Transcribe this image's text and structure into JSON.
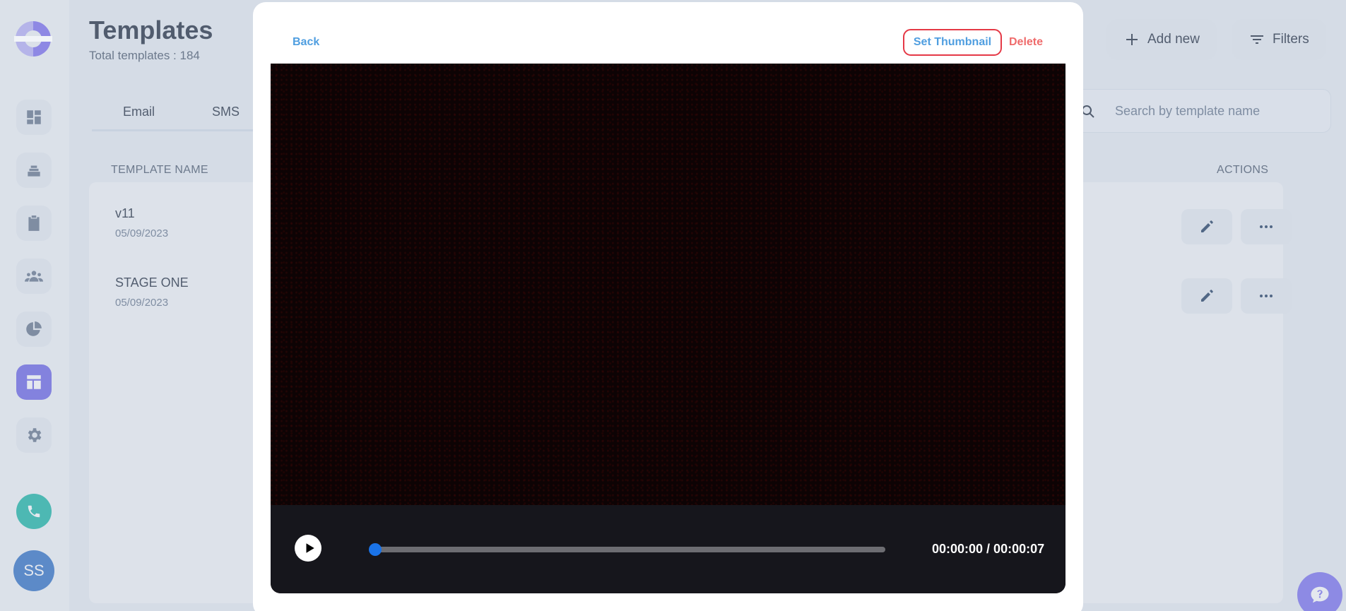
{
  "sidebar": {
    "avatar_initials": "SS",
    "active_item": "templates"
  },
  "header": {
    "title": "Templates",
    "subtitle": "Total templates : 184",
    "add_new_label": "Add new",
    "filters_label": "Filters"
  },
  "tabs": [
    {
      "label": "Email"
    },
    {
      "label": "SMS"
    }
  ],
  "search": {
    "placeholder": "Search by template name"
  },
  "table": {
    "columns": {
      "name": "TEMPLATE NAME",
      "actions": "ACTIONS"
    },
    "rows": [
      {
        "name": "v11",
        "date": "05/09/2023"
      },
      {
        "name": "STAGE ONE",
        "date": "05/09/2023"
      }
    ]
  },
  "modal": {
    "back_label": "Back",
    "set_thumbnail_label": "Set Thumbnail",
    "delete_label": "Delete",
    "video": {
      "time_display": "00:00:00 / 00:00:07",
      "progress": 0
    }
  },
  "colors": {
    "accent": "#6b63e6",
    "link": "#4f9ee0",
    "danger": "#e53946",
    "progress": "#1a73e8"
  }
}
